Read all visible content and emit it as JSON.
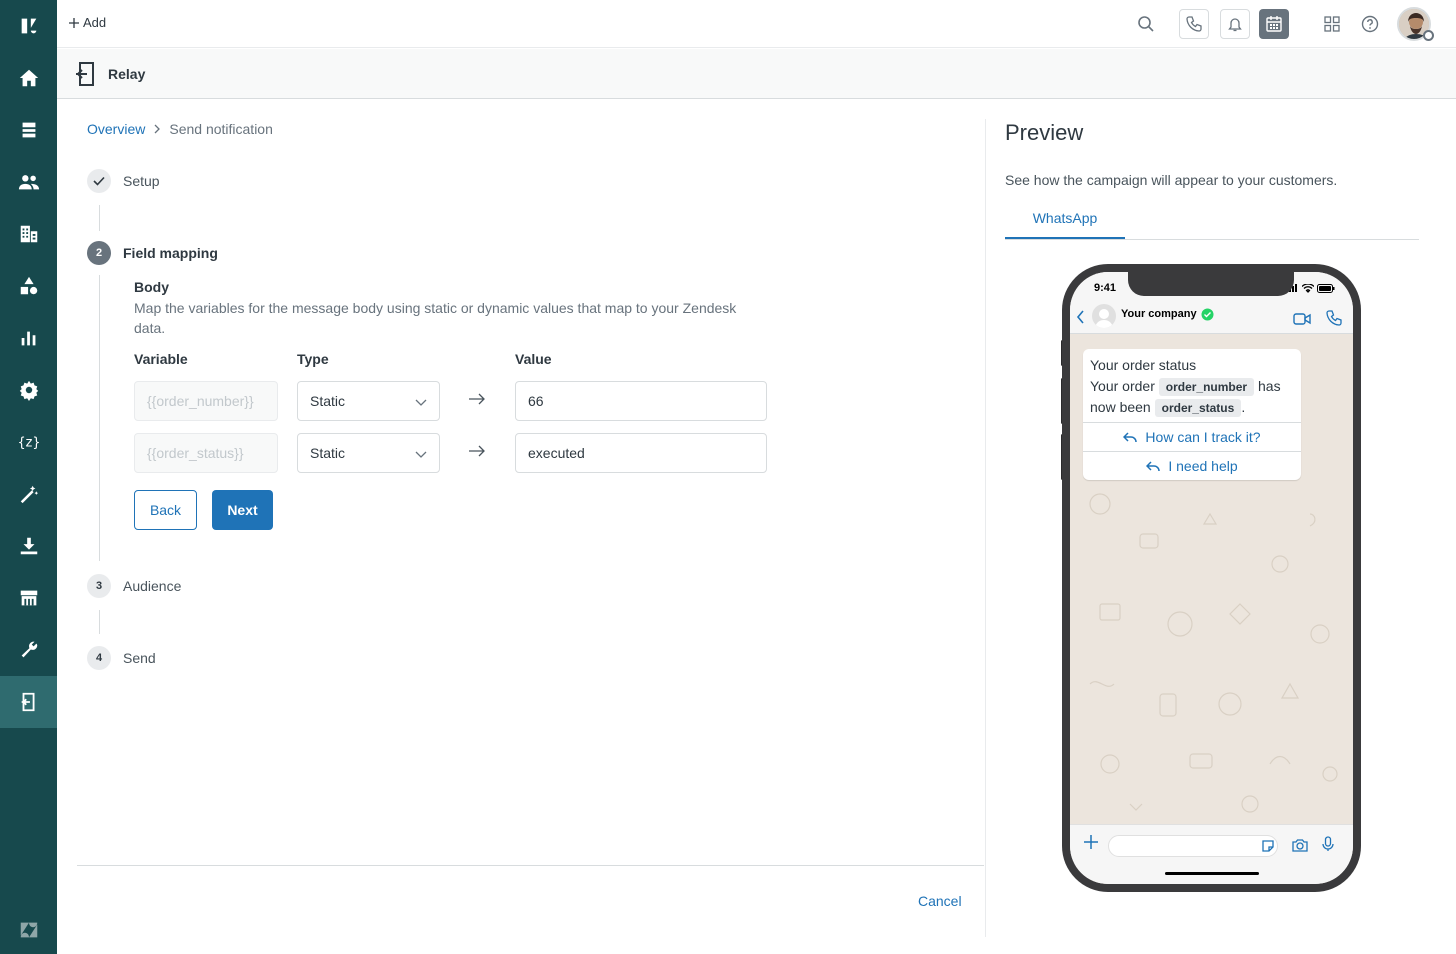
{
  "topbar": {
    "add_label": "Add"
  },
  "subheader": {
    "app_title": "Relay"
  },
  "breadcrumb": {
    "overview": "Overview",
    "current": "Send notification"
  },
  "steps": [
    {
      "number": "",
      "label": "Setup",
      "state": "done"
    },
    {
      "number": "2",
      "label": "Field mapping",
      "state": "current"
    },
    {
      "number": "3",
      "label": "Audience",
      "state": "todo"
    },
    {
      "number": "4",
      "label": "Send",
      "state": "todo"
    }
  ],
  "body_section": {
    "title": "Body",
    "description": "Map the variables for the message body using static or dynamic values that map to your Zendesk data."
  },
  "mapping": {
    "headers": {
      "variable": "Variable",
      "type": "Type",
      "value": "Value"
    },
    "rows": [
      {
        "variable": "{{order_number}}",
        "type": "Static",
        "value": "66"
      },
      {
        "variable": "{{order_status}}",
        "type": "Static",
        "value": "executed"
      }
    ]
  },
  "buttons": {
    "back": "Back",
    "next": "Next",
    "cancel": "Cancel"
  },
  "preview": {
    "title": "Preview",
    "description": "See how the campaign will appear to your customers.",
    "tab": "WhatsApp",
    "phone": {
      "time": "9:41",
      "contact": "Your company",
      "message_title": "Your order status",
      "message_prefix": "Your order",
      "chip1": "order_number",
      "message_mid_a": "has",
      "message_mid_b": "now been",
      "chip2": "order_status",
      "message_end": ".",
      "quick_replies": [
        "How can I track it?",
        "I need help"
      ]
    }
  },
  "colors": {
    "nav_bg": "#17494d",
    "accent": "#1f73b7"
  }
}
